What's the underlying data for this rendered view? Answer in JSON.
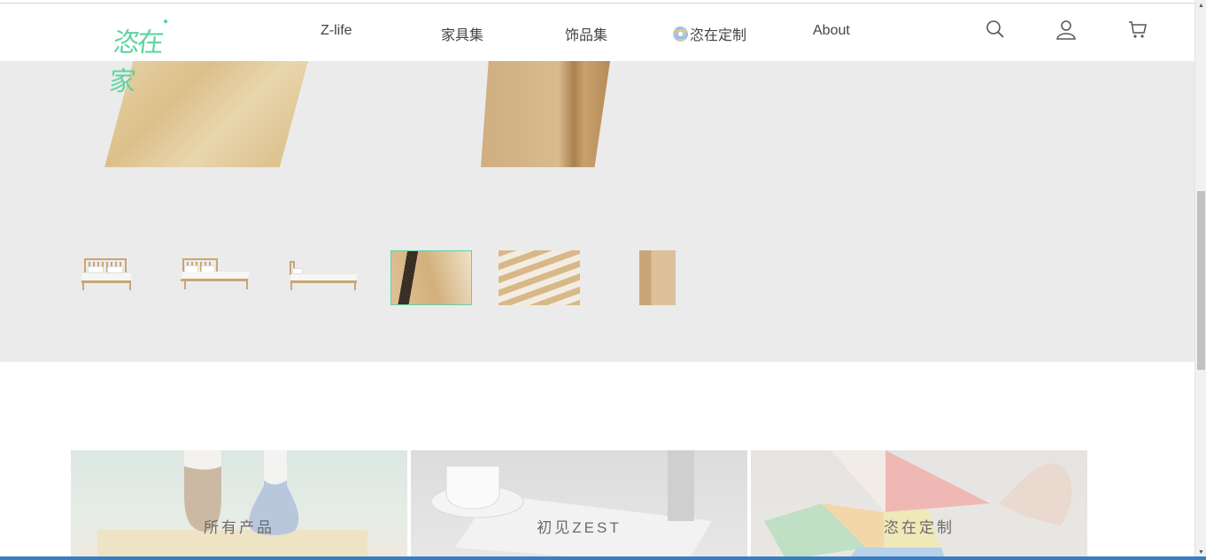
{
  "brand": {
    "logo_text": "恣在家",
    "accent_color": "#5fd3a2"
  },
  "nav": {
    "items": [
      {
        "label": "Z-life"
      },
      {
        "label": "家具集"
      },
      {
        "label": "饰品集"
      },
      {
        "label": "恣在定制"
      },
      {
        "label": "About"
      }
    ]
  },
  "header_icons": [
    "search-icon",
    "user-icon",
    "cart-icon"
  ],
  "gallery": {
    "thumbnails": [
      {
        "name": "bed-front-view",
        "active": false
      },
      {
        "name": "bed-angle-view",
        "active": false
      },
      {
        "name": "bed-side-view",
        "active": false
      },
      {
        "name": "headboard-detail",
        "active": true
      },
      {
        "name": "slats-detail",
        "active": false
      },
      {
        "name": "frame-corner-detail",
        "active": false
      }
    ]
  },
  "categories": [
    {
      "label": "所有产品"
    },
    {
      "label": "初见ZEST"
    },
    {
      "label": "恣在定制"
    }
  ]
}
